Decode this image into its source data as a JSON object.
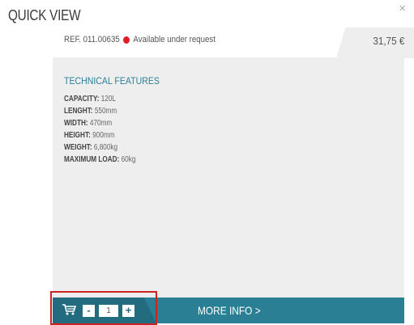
{
  "header": {
    "title": "QUICK VIEW",
    "close_icon": "×"
  },
  "product": {
    "ref": "REF. 011.00635",
    "availability": "Available under request",
    "availability_color": "#e31b23",
    "price": "31,75 €"
  },
  "features": {
    "title": "TECHNICAL FEATURES",
    "items": [
      {
        "label": "CAPACITY:",
        "value": " 120L"
      },
      {
        "label": "LENGHT:",
        "value": " 550mm"
      },
      {
        "label": "WIDTH:",
        "value": " 470mm"
      },
      {
        "label": "HEIGHT:",
        "value": " 900mm"
      },
      {
        "label": "WEIGHT:",
        "value": " 6,800kg"
      },
      {
        "label": "MAXIMUM LOAD:",
        "value": " 60kg"
      }
    ]
  },
  "cart": {
    "icon": "cart-icon",
    "minus_label": "-",
    "quantity": "1",
    "plus_label": "+",
    "more_info_label": "MORE INFO >"
  },
  "colors": {
    "accent": "#2a7f95",
    "accent_dark": "#236c80",
    "panel": "#eeeeee",
    "highlight": "#cc2222"
  }
}
